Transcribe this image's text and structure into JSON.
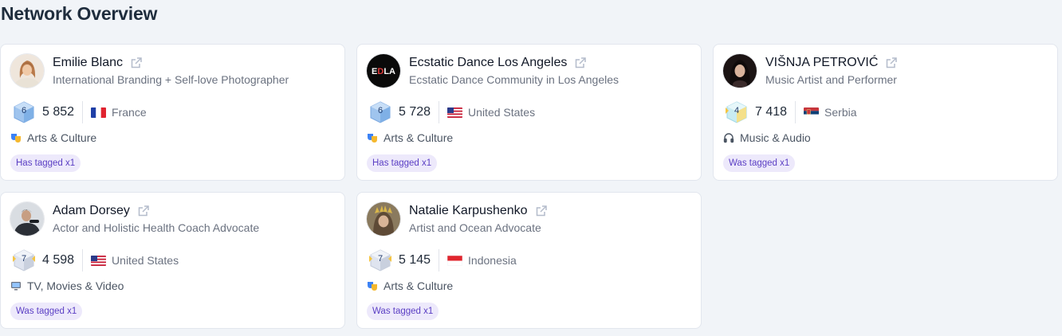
{
  "page": {
    "title": "Network Overview"
  },
  "cards": [
    {
      "name": "Emilie Blanc",
      "subtitle": "International Branding + Self-love Photographer",
      "level": "6",
      "followers": "5 852",
      "country": "France",
      "flag": "france-flag",
      "category": "Arts & Culture",
      "category_icon": "theater-masks-icon",
      "tag": "Has tagged x1",
      "avatar": "woman-portrait"
    },
    {
      "name": "Ecstatic Dance Los Angeles",
      "subtitle": "Ecstatic Dance Community in Los Angeles",
      "level": "6",
      "followers": "5 728",
      "country": "United States",
      "flag": "usa-flag",
      "category": "Arts & Culture",
      "category_icon": "theater-masks-icon",
      "tag": "Has tagged x1",
      "avatar": "edla-logo",
      "logo_text": "EDLA"
    },
    {
      "name": "VIŠNJA PETROVIĆ",
      "subtitle": "Music Artist and Performer",
      "level": "4",
      "followers": "7 418",
      "country": "Serbia",
      "flag": "serbia-flag",
      "category": "Music & Audio",
      "category_icon": "headphones-icon",
      "tag": "Was tagged x1",
      "avatar": "woman-dark-portrait"
    },
    {
      "name": "Adam Dorsey",
      "subtitle": "Actor and Holistic Health Coach Advocate",
      "level": "7",
      "followers": "4 598",
      "country": "United States",
      "flag": "usa-flag",
      "category": "TV, Movies & Video",
      "category_icon": "tv-icon",
      "tag": "Was tagged x1",
      "avatar": "man-portrait"
    },
    {
      "name": "Natalie Karpushenko",
      "subtitle": "Artist and Ocean Advocate",
      "level": "7",
      "followers": "5 145",
      "country": "Indonesia",
      "flag": "indonesia-flag",
      "category": "Arts & Culture",
      "category_icon": "theater-masks-icon",
      "tag": "Was tagged x1",
      "avatar": "woman-crown-portrait"
    }
  ],
  "colors": {
    "background": "#f1f4f8",
    "card": "#ffffff",
    "tag_bg": "#ede9fb",
    "tag_text": "#5b3fc4",
    "level6": "#8fb6e6",
    "level7": "#cfd6e6",
    "level4": "#bfe3ef"
  }
}
